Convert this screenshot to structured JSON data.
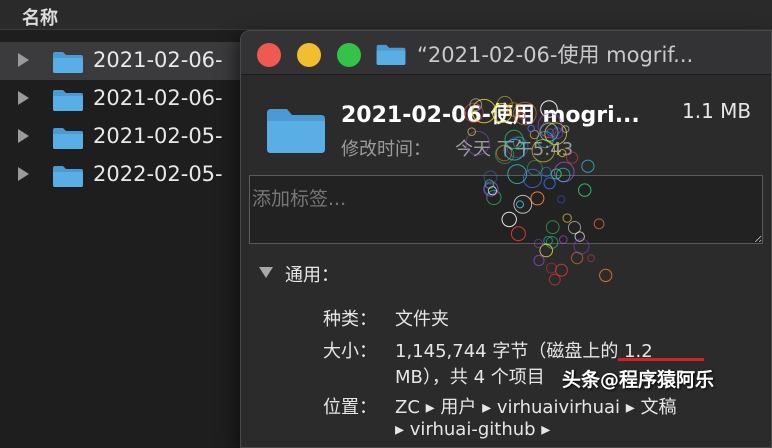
{
  "finder": {
    "column_header": "名称",
    "rows": [
      {
        "name": "2021-02-06-"
      },
      {
        "name": "2021-02-06-"
      },
      {
        "name": "2021-02-05-"
      },
      {
        "name": "2022-02-05-"
      }
    ]
  },
  "info_window": {
    "title": "“2021-02-06-使用 mogrif...",
    "file_name": "2021-02-06-使用 mogri...",
    "file_size": "1.1 MB",
    "modified_label": "修改时间：",
    "modified_value": "今天 下午5:43",
    "tags_placeholder": "添加标签...",
    "general_title": "通用：",
    "kind_label": "种类：",
    "kind_value": "文件夹",
    "size_label": "大小：",
    "size_value_line1": "1,145,744 字节（磁盘上的 1.2",
    "size_value_line2": "MB），共 4 个项目",
    "where_label": "位置：",
    "where_value_line1": "ZC ▸ 用户 ▸ virhuaivirhuai ▸ 文稿",
    "where_value_line2": "▸ virhuai-github ▸"
  },
  "watermark": "头条@程序猿阿乐",
  "colors": {
    "folder": "#5aaee6",
    "close": "#ee5a52",
    "minimize": "#f2be2f",
    "zoom": "#35c248",
    "annotation_red": "#d22323"
  },
  "icons": {
    "disclosure_collapsed": "triangle-right-icon",
    "disclosure_expanded": "triangle-down-icon",
    "folder": "folder-icon"
  }
}
